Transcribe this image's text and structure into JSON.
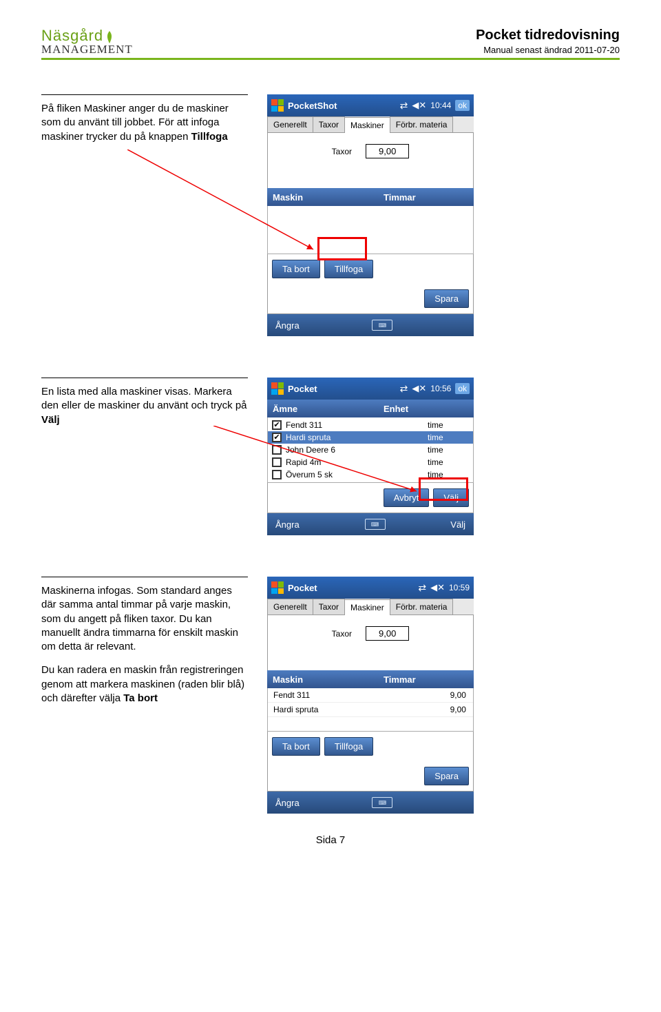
{
  "header": {
    "logo_top": "Näsgård",
    "logo_bot": "MANAGEMENT",
    "title": "Pocket tidredovisning",
    "subtitle": "Manual senast ändrad 2011-07-20"
  },
  "section1": {
    "text_a": "På fliken Maskiner anger du de maskiner som du använt till jobbet. För att infoga maskiner trycker du på knappen ",
    "text_b": "Tillfoga",
    "shot": {
      "sb_title": "PocketShot",
      "sb_time": "10:44",
      "sb_ok": "ok",
      "tabs": [
        "Generellt",
        "Taxor",
        "Maskiner",
        "Förbr. materia"
      ],
      "active_tab": 2,
      "field_label": "Taxor",
      "field_value": "9,00",
      "grid_h1": "Maskin",
      "grid_h2": "Timmar",
      "btn_tabort": "Ta bort",
      "btn_tillfoga": "Tillfoga",
      "btn_spara": "Spara",
      "bar_left": "Ångra"
    }
  },
  "section2": {
    "text_a": "En lista med alla maskiner visas. Markera den eller de maskiner du använt och tryck på ",
    "text_b": "Välj",
    "shot": {
      "sb_title": "Pocket",
      "sb_time": "10:56",
      "sb_ok": "ok",
      "grid_h1": "Ämne",
      "grid_h2": "Enhet",
      "rows": [
        {
          "chk": true,
          "name": "Fendt 311",
          "unit": "time",
          "hl": false
        },
        {
          "chk": true,
          "name": "Hardi spruta",
          "unit": "time",
          "hl": true
        },
        {
          "chk": false,
          "name": "John Deere 6",
          "unit": "time",
          "hl": false
        },
        {
          "chk": false,
          "name": "Rapid 4m",
          "unit": "time",
          "hl": false
        },
        {
          "chk": false,
          "name": "Överum 5 sk",
          "unit": "time",
          "hl": false
        }
      ],
      "btn_avbryt": "Avbryt",
      "btn_valj": "Välj",
      "bar_left": "Ångra",
      "bar_right": "Välj"
    }
  },
  "section3": {
    "text_a": "Maskinerna infogas. Som standard anges där samma antal timmar på varje maskin, som du angett på fliken taxor. Du kan manuellt ändra timmarna för enskilt maskin om detta är relevant.",
    "text_b": "Du kan radera en maskin från registreringen genom att markera maskinen (raden blir blå) och därefter välja ",
    "text_c": "Ta bort",
    "shot": {
      "sb_title": "Pocket",
      "sb_time": "10:59",
      "tabs": [
        "Generellt",
        "Taxor",
        "Maskiner",
        "Förbr. materia"
      ],
      "active_tab": 2,
      "field_label": "Taxor",
      "field_value": "9,00",
      "grid_h1": "Maskin",
      "grid_h2": "Timmar",
      "rows": [
        {
          "name": "Fendt 311",
          "val": "9,00"
        },
        {
          "name": "Hardi spruta",
          "val": "9,00"
        }
      ],
      "btn_tabort": "Ta bort",
      "btn_tillfoga": "Tillfoga",
      "btn_spara": "Spara",
      "bar_left": "Ångra"
    }
  },
  "footer_label": "Sida",
  "footer_page": "7"
}
